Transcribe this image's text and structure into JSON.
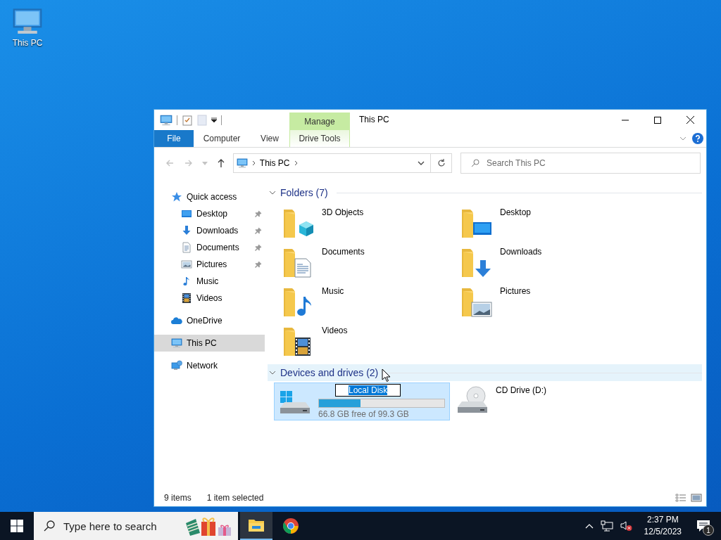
{
  "desktop": {
    "icons": [
      {
        "label": "This PC"
      }
    ]
  },
  "window": {
    "title": "This PC",
    "context_tab": "Manage",
    "ribbon_tabs": [
      {
        "label": "File",
        "kind": "file"
      },
      {
        "label": "Computer",
        "kind": "tab"
      },
      {
        "label": "View",
        "kind": "tab"
      },
      {
        "label": "Drive Tools",
        "kind": "context"
      }
    ],
    "nav_buttons": [
      {
        "kind": "back",
        "disabled": true
      },
      {
        "kind": "forward",
        "disabled": true
      },
      {
        "kind": "recent",
        "disabled": true
      },
      {
        "kind": "up",
        "disabled": false
      }
    ],
    "address": {
      "path": "This PC"
    },
    "search": {
      "placeholder": "Search This PC"
    },
    "navigation": [
      {
        "label": "Quick access",
        "kind": "quick-access",
        "selected": false,
        "children": [
          {
            "label": "Desktop",
            "kind": "desktop",
            "pinned": true,
            "selected": false
          },
          {
            "label": "Downloads",
            "kind": "downloads",
            "pinned": true,
            "selected": false
          },
          {
            "label": "Documents",
            "kind": "documents",
            "pinned": true,
            "selected": false
          },
          {
            "label": "Pictures",
            "kind": "pictures",
            "pinned": true,
            "selected": false
          },
          {
            "label": "Music",
            "kind": "music",
            "pinned": false,
            "selected": false
          },
          {
            "label": "Videos",
            "kind": "videos",
            "pinned": false,
            "selected": false
          }
        ]
      },
      {
        "label": "OneDrive",
        "kind": "onedrive",
        "selected": false
      },
      {
        "label": "This PC",
        "kind": "pc",
        "selected": true
      },
      {
        "label": "Network",
        "kind": "network",
        "selected": false
      }
    ],
    "groups": [
      {
        "title": "Folders (7)",
        "expanded": true,
        "hovered": false,
        "items": [
          {
            "name": "3D Objects",
            "kind": "objects3d",
            "selected": false
          },
          {
            "name": "Desktop",
            "kind": "desktop",
            "selected": false
          },
          {
            "name": "Documents",
            "kind": "documents",
            "selected": false
          },
          {
            "name": "Downloads",
            "kind": "downloads",
            "selected": false
          },
          {
            "name": "Music",
            "kind": "music",
            "selected": false
          },
          {
            "name": "Pictures",
            "kind": "pictures",
            "selected": false
          },
          {
            "name": "Videos",
            "kind": "videos",
            "selected": false
          }
        ]
      },
      {
        "title": "Devices and drives (2)",
        "expanded": true,
        "hovered": true,
        "items": [
          {
            "name": "Local Disk",
            "kind": "system-drive",
            "selected": true,
            "renaming": true,
            "level": 0.33,
            "free": "66.8 GB free of 99.3 GB"
          },
          {
            "name": "CD Drive (D:)",
            "kind": "cd-drive",
            "selected": false,
            "renaming": false
          }
        ]
      }
    ],
    "status_bar": {
      "item_count": "9 items",
      "selection": "1 item selected"
    }
  },
  "taskbar": {
    "search": {
      "placeholder": "Type here to search"
    },
    "apps": [
      {
        "kind": "explorer",
        "active": true
      },
      {
        "kind": "chrome",
        "active": false
      }
    ],
    "tray": {
      "muted": true,
      "time": "2:37 PM",
      "date": "12/5/2023",
      "notifications": "1"
    }
  }
}
